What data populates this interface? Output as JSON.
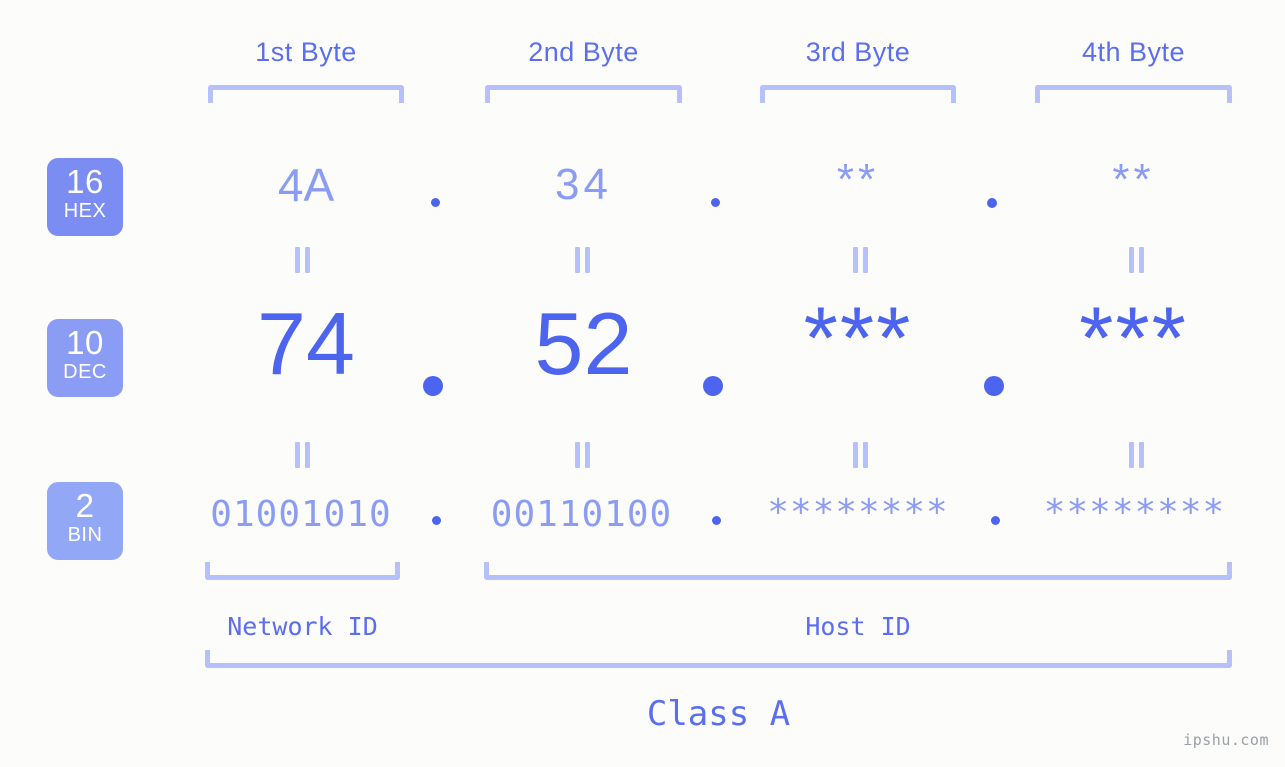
{
  "meta": {
    "background_color": "#fcfdfa",
    "accent_strong": "#4d64ef",
    "accent_mid": "#5b6ef0",
    "accent_light": "#8b9cf5",
    "accent_pale": "#b6c0fb",
    "watermark": "ipshu.com"
  },
  "headers": [
    {
      "label": "1st Byte"
    },
    {
      "label": "2nd Byte"
    },
    {
      "label": "3rd Byte"
    },
    {
      "label": "4th Byte"
    }
  ],
  "bases": [
    {
      "number": "16",
      "name": "HEX",
      "color": "#7b8cf2"
    },
    {
      "number": "10",
      "name": "DEC",
      "color": "#8b9cf5"
    },
    {
      "number": "2",
      "name": "BIN",
      "color": "#93a7f7"
    }
  ],
  "rows": {
    "hex": {
      "values": [
        "4A",
        "34",
        "**",
        "**"
      ],
      "separator": "."
    },
    "dec": {
      "values": [
        "74",
        "52",
        "***",
        "***"
      ],
      "separator": "."
    },
    "bin": {
      "values": [
        "01001010",
        "00110100",
        "********",
        "********"
      ],
      "separator": "."
    }
  },
  "equality_symbol": "=",
  "segments": {
    "network_id": "Network ID",
    "host_id": "Host ID",
    "class": "Class A"
  }
}
